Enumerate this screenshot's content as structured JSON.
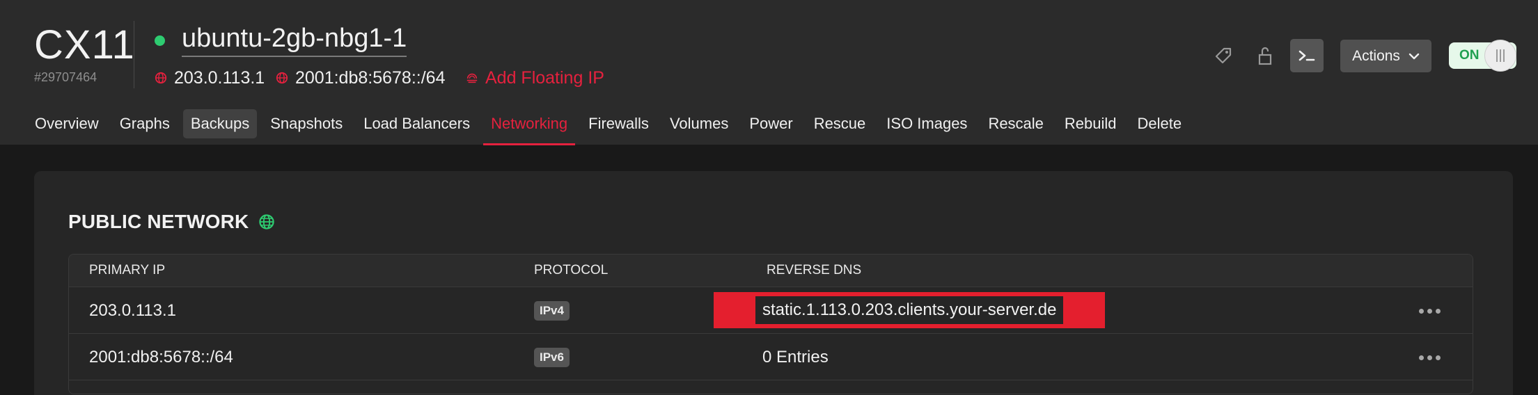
{
  "server": {
    "type": "CX11",
    "id": "#29707464",
    "name": "ubuntu-2gb-nbg1-1",
    "status_color": "#2ecc71",
    "ipv4": "203.0.113.1",
    "ipv6": "2001:db8:5678::/64",
    "add_floating_ip": "Add Floating IP"
  },
  "toolbar": {
    "actions_label": "Actions",
    "power_label": "ON",
    "icons": [
      "tag-icon",
      "lock-icon",
      "console-icon",
      "chevron-down-icon"
    ]
  },
  "tabs": [
    {
      "label": "Overview"
    },
    {
      "label": "Graphs"
    },
    {
      "label": "Backups"
    },
    {
      "label": "Snapshots"
    },
    {
      "label": "Load Balancers"
    },
    {
      "label": "Networking"
    },
    {
      "label": "Firewalls"
    },
    {
      "label": "Volumes"
    },
    {
      "label": "Power"
    },
    {
      "label": "Rescue"
    },
    {
      "label": "ISO Images"
    },
    {
      "label": "Rescale"
    },
    {
      "label": "Rebuild"
    },
    {
      "label": "Delete"
    }
  ],
  "active_tab": "Networking",
  "hovered_tab": "Backups",
  "public_network": {
    "title": "PUBLIC NETWORK",
    "columns": {
      "primary_ip": "PRIMARY IP",
      "protocol": "PROTOCOL",
      "reverse_dns": "REVERSE DNS"
    },
    "rows": [
      {
        "ip": "203.0.113.1",
        "protocol": "IPv4",
        "reverse_dns": "static.1.113.0.203.clients.your-server.de"
      },
      {
        "ip": "2001:db8:5678::/64",
        "protocol": "IPv6",
        "reverse_dns": "0 Entries"
      }
    ]
  },
  "colors": {
    "accent": "#e5213e",
    "header_bg": "#2b2b2b",
    "page_bg": "#191919",
    "success": "#2ecc71"
  }
}
